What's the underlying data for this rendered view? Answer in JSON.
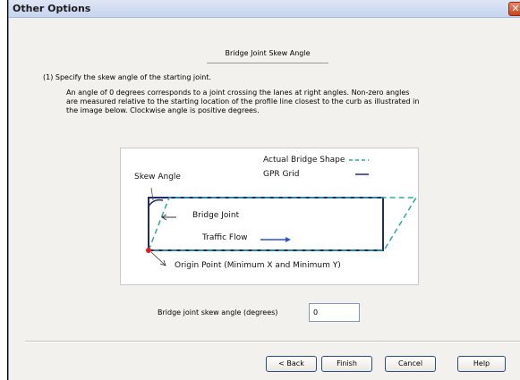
{
  "window": {
    "title": "Other Options",
    "close_glyph": "✕"
  },
  "section": {
    "heading": "Bridge Joint Skew Angle",
    "step_text": "(1) Specify the skew angle of the starting joint.",
    "description_lines": [
      "An angle of 0 degrees corresponds to a joint crossing the lanes at right angles. Non-zero angles",
      "are measured relative to the starting location of the profile line closest to the curb as illustrated in",
      "the image below. Clockwise angle is positive degrees."
    ]
  },
  "diagram": {
    "legend_actual": "Actual Bridge Shape",
    "legend_grid": "GPR Grid",
    "skew_angle": "Skew Angle",
    "bridge_joint": "Bridge Joint",
    "traffic_flow": "Traffic Flow",
    "origin_point": "Origin Point (Minimum X and Minimum Y)",
    "colors": {
      "grid": "#1f2a6b",
      "actual": "#2aa9a9",
      "origin": "#e02020",
      "arrow": "#2a52c9"
    }
  },
  "field": {
    "label": "Bridge joint skew angle (degrees)",
    "value": "0"
  },
  "buttons": {
    "back": "< Back",
    "finish": "Finish",
    "cancel": "Cancel",
    "help": "Help"
  }
}
